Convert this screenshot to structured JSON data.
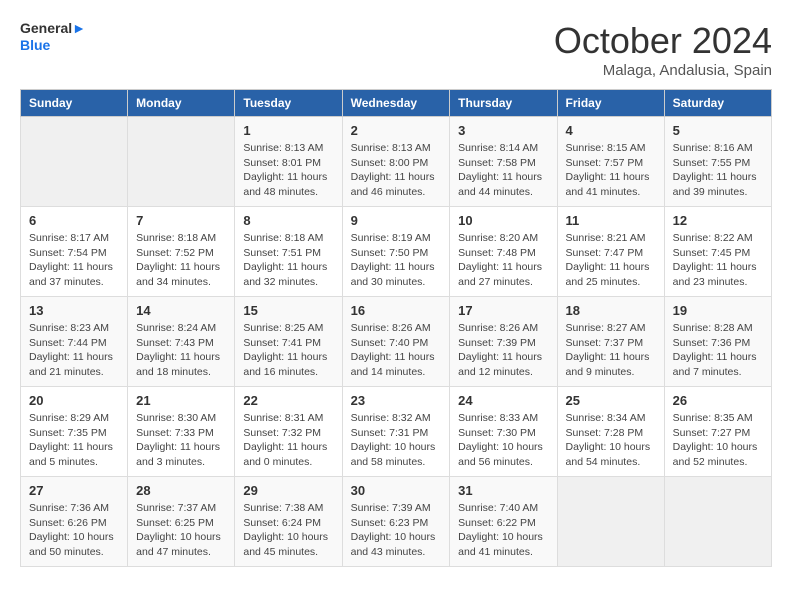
{
  "logo": {
    "text_general": "General",
    "text_blue": "Blue"
  },
  "calendar": {
    "title": "October 2024",
    "subtitle": "Malaga, Andalusia, Spain"
  },
  "weekdays": [
    "Sunday",
    "Monday",
    "Tuesday",
    "Wednesday",
    "Thursday",
    "Friday",
    "Saturday"
  ],
  "weeks": [
    [
      {
        "day": "",
        "info": ""
      },
      {
        "day": "",
        "info": ""
      },
      {
        "day": "1",
        "info": "Sunrise: 8:13 AM\nSunset: 8:01 PM\nDaylight: 11 hours and 48 minutes."
      },
      {
        "day": "2",
        "info": "Sunrise: 8:13 AM\nSunset: 8:00 PM\nDaylight: 11 hours and 46 minutes."
      },
      {
        "day": "3",
        "info": "Sunrise: 8:14 AM\nSunset: 7:58 PM\nDaylight: 11 hours and 44 minutes."
      },
      {
        "day": "4",
        "info": "Sunrise: 8:15 AM\nSunset: 7:57 PM\nDaylight: 11 hours and 41 minutes."
      },
      {
        "day": "5",
        "info": "Sunrise: 8:16 AM\nSunset: 7:55 PM\nDaylight: 11 hours and 39 minutes."
      }
    ],
    [
      {
        "day": "6",
        "info": "Sunrise: 8:17 AM\nSunset: 7:54 PM\nDaylight: 11 hours and 37 minutes."
      },
      {
        "day": "7",
        "info": "Sunrise: 8:18 AM\nSunset: 7:52 PM\nDaylight: 11 hours and 34 minutes."
      },
      {
        "day": "8",
        "info": "Sunrise: 8:18 AM\nSunset: 7:51 PM\nDaylight: 11 hours and 32 minutes."
      },
      {
        "day": "9",
        "info": "Sunrise: 8:19 AM\nSunset: 7:50 PM\nDaylight: 11 hours and 30 minutes."
      },
      {
        "day": "10",
        "info": "Sunrise: 8:20 AM\nSunset: 7:48 PM\nDaylight: 11 hours and 27 minutes."
      },
      {
        "day": "11",
        "info": "Sunrise: 8:21 AM\nSunset: 7:47 PM\nDaylight: 11 hours and 25 minutes."
      },
      {
        "day": "12",
        "info": "Sunrise: 8:22 AM\nSunset: 7:45 PM\nDaylight: 11 hours and 23 minutes."
      }
    ],
    [
      {
        "day": "13",
        "info": "Sunrise: 8:23 AM\nSunset: 7:44 PM\nDaylight: 11 hours and 21 minutes."
      },
      {
        "day": "14",
        "info": "Sunrise: 8:24 AM\nSunset: 7:43 PM\nDaylight: 11 hours and 18 minutes."
      },
      {
        "day": "15",
        "info": "Sunrise: 8:25 AM\nSunset: 7:41 PM\nDaylight: 11 hours and 16 minutes."
      },
      {
        "day": "16",
        "info": "Sunrise: 8:26 AM\nSunset: 7:40 PM\nDaylight: 11 hours and 14 minutes."
      },
      {
        "day": "17",
        "info": "Sunrise: 8:26 AM\nSunset: 7:39 PM\nDaylight: 11 hours and 12 minutes."
      },
      {
        "day": "18",
        "info": "Sunrise: 8:27 AM\nSunset: 7:37 PM\nDaylight: 11 hours and 9 minutes."
      },
      {
        "day": "19",
        "info": "Sunrise: 8:28 AM\nSunset: 7:36 PM\nDaylight: 11 hours and 7 minutes."
      }
    ],
    [
      {
        "day": "20",
        "info": "Sunrise: 8:29 AM\nSunset: 7:35 PM\nDaylight: 11 hours and 5 minutes."
      },
      {
        "day": "21",
        "info": "Sunrise: 8:30 AM\nSunset: 7:33 PM\nDaylight: 11 hours and 3 minutes."
      },
      {
        "day": "22",
        "info": "Sunrise: 8:31 AM\nSunset: 7:32 PM\nDaylight: 11 hours and 0 minutes."
      },
      {
        "day": "23",
        "info": "Sunrise: 8:32 AM\nSunset: 7:31 PM\nDaylight: 10 hours and 58 minutes."
      },
      {
        "day": "24",
        "info": "Sunrise: 8:33 AM\nSunset: 7:30 PM\nDaylight: 10 hours and 56 minutes."
      },
      {
        "day": "25",
        "info": "Sunrise: 8:34 AM\nSunset: 7:28 PM\nDaylight: 10 hours and 54 minutes."
      },
      {
        "day": "26",
        "info": "Sunrise: 8:35 AM\nSunset: 7:27 PM\nDaylight: 10 hours and 52 minutes."
      }
    ],
    [
      {
        "day": "27",
        "info": "Sunrise: 7:36 AM\nSunset: 6:26 PM\nDaylight: 10 hours and 50 minutes."
      },
      {
        "day": "28",
        "info": "Sunrise: 7:37 AM\nSunset: 6:25 PM\nDaylight: 10 hours and 47 minutes."
      },
      {
        "day": "29",
        "info": "Sunrise: 7:38 AM\nSunset: 6:24 PM\nDaylight: 10 hours and 45 minutes."
      },
      {
        "day": "30",
        "info": "Sunrise: 7:39 AM\nSunset: 6:23 PM\nDaylight: 10 hours and 43 minutes."
      },
      {
        "day": "31",
        "info": "Sunrise: 7:40 AM\nSunset: 6:22 PM\nDaylight: 10 hours and 41 minutes."
      },
      {
        "day": "",
        "info": ""
      },
      {
        "day": "",
        "info": ""
      }
    ]
  ]
}
